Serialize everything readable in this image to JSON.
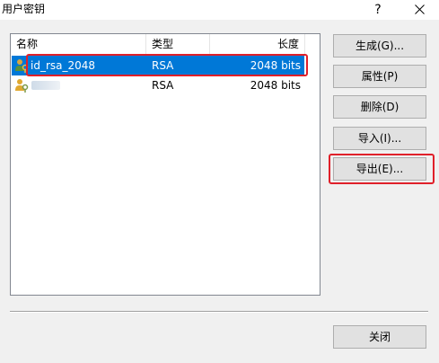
{
  "window": {
    "title": "用户密钥",
    "help_label": "?",
    "close_icon": "close-icon"
  },
  "list": {
    "columns": [
      "名称",
      "类型",
      "长度"
    ],
    "rows": [
      {
        "name": "id_rsa_2048",
        "type": "RSA",
        "length": "2048 bits",
        "icon": "user-key-icon",
        "selected": true
      },
      {
        "name": "",
        "type": "RSA",
        "length": "2048 bits",
        "icon": "user-key-icon",
        "selected": false
      }
    ]
  },
  "buttons": {
    "generate": "生成(G)...",
    "properties": "属性(P)",
    "delete": "删除(D)",
    "import": "导入(I)...",
    "export": "导出(E)...",
    "close": "关闭"
  },
  "colors": {
    "selection": "#0078d7",
    "highlight": "#e0202a"
  }
}
